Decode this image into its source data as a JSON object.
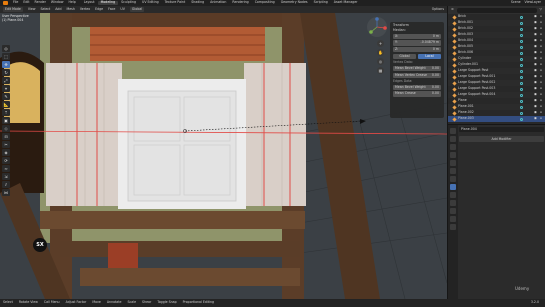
{
  "topbar": {
    "menus": [
      "File",
      "Edit",
      "Render",
      "Window",
      "Help"
    ],
    "workspaces": [
      "Layout",
      "Modeling",
      "Sculpting",
      "UV Editing",
      "Texture Paint",
      "Shading",
      "Animation",
      "Rendering",
      "Compositing",
      "Geometry Nodes",
      "Scripting",
      "Asset Manager"
    ],
    "active_workspace": "Modeling",
    "scene": "Scene",
    "view_layer": "ViewLayer"
  },
  "viewport_header": {
    "mode": "Edit Mode",
    "menus": [
      "View",
      "Select",
      "Add",
      "Mesh",
      "Vertex",
      "Edge",
      "Face",
      "UV"
    ],
    "orientation": "Global",
    "options": "Options"
  },
  "viewport": {
    "stats": [
      "User Perspective",
      "(1) Plane.004"
    ],
    "key_badge": "SX"
  },
  "toolbar": {
    "tools": [
      "cursor-icon",
      "select-icon",
      "move-icon",
      "rotate-icon",
      "scale-icon",
      "transform-icon",
      "annotate-icon",
      "measure-icon",
      "extrude-icon",
      "inset-icon",
      "bevel-icon",
      "loopcut-icon",
      "knife-icon",
      "polybuild-icon",
      "spin-icon",
      "smooth-icon",
      "shrink-icon",
      "shear-icon",
      "rip-icon"
    ],
    "active_index": 2
  },
  "npanel": {
    "title": "Transform",
    "median_label": "Median:",
    "x": "0 m",
    "y": "-0.04879 m",
    "z": "0 m",
    "global": "Global",
    "local": "Local",
    "vertex_weights_label": "Vertex Data:",
    "bevel_weight_label": "Mean Bevel Weight",
    "bevel_weight_value": "0.00",
    "vertex_crease_label": "Mean Vertex Crease",
    "vertex_crease_value": "0.00",
    "edge_data_label": "Edges Data:",
    "edge_bevel_label": "Mean Bevel Weight",
    "edge_bevel_value": "0.00",
    "edge_crease_label": "Mean Crease",
    "edge_crease_value": "0.00"
  },
  "outliner": {
    "items": [
      {
        "name": "Brick"
      },
      {
        "name": "Brick.001"
      },
      {
        "name": "Brick.002"
      },
      {
        "name": "Brick.003"
      },
      {
        "name": "Brick.004"
      },
      {
        "name": "Brick.005"
      },
      {
        "name": "Brick.006"
      },
      {
        "name": "Cylinder"
      },
      {
        "name": "Cylinder.001"
      },
      {
        "name": "Large Support Post"
      },
      {
        "name": "Large Support Post.001"
      },
      {
        "name": "Large Support Post.002"
      },
      {
        "name": "Large Support Post.003"
      },
      {
        "name": "Large Support Post.004"
      },
      {
        "name": "Plane"
      },
      {
        "name": "Plane.001"
      },
      {
        "name": "Plane.002"
      },
      {
        "name": "Plane.003"
      }
    ],
    "selected_index": 17
  },
  "properties": {
    "object_name": "Plane.004",
    "add_modifier": "Add Modifier"
  },
  "statusbar": {
    "items": [
      "Select",
      "Rotate View",
      "Call Menu",
      "Adjust Factor",
      "Move",
      "Annotate",
      "Scale",
      "Shear",
      "Toggle Snap",
      "Proportional Editing"
    ],
    "version": "3.2.0"
  },
  "watermark": "Udemy"
}
